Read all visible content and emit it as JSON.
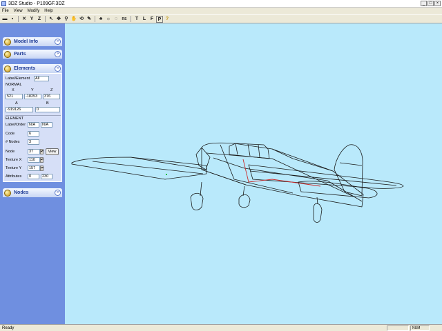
{
  "window": {
    "title": "3DZ Studio - P109GF.3DZ"
  },
  "menu": [
    "File",
    "View",
    "Modify",
    "Help"
  ],
  "toolbar": {
    "letter_buttons": {
      "t": "T",
      "l": "L",
      "f": "F",
      "p": "P"
    },
    "rs": "RS"
  },
  "panels": {
    "model_info": "Model Info",
    "parts": "Parts",
    "elements": "Elements",
    "nodes": "Nodes"
  },
  "elements_form": {
    "label_element_label": "Label/Element",
    "label_element_value": "All",
    "mode": "NORMAL",
    "x_label": "X",
    "y_label": "Y",
    "z_label": "Z",
    "x_value": "521",
    "y_value": "-18253",
    "z_value": "376",
    "a_label": "A",
    "b_label": "B",
    "a_value": "-919126",
    "b_value": "0",
    "element_header": "ELEMENT",
    "label_order_label": "Label/Order",
    "label_order_value1": "N/A",
    "label_order_value2": "N/A",
    "code_label": "Code",
    "code_value": "6",
    "nnodes_label": "# Nodes",
    "nnodes_value": "3",
    "node_label": "Node",
    "node_value": "37",
    "view_button": "View",
    "texture_x_label": "Texture X",
    "texture_x_value": "110",
    "texture_y_label": "Texture Y",
    "texture_y_value": "157",
    "attributes_label": "Attributes",
    "attributes_value1": "0",
    "attributes_value2": "230"
  },
  "status": {
    "left": "Ready",
    "right": "NUM"
  },
  "colors": {
    "viewport_bg": "#b9e9fb",
    "sidebar_bg": "#6f8fe0",
    "wireframe": "#1a1a1a",
    "highlight": "#cc2a2a",
    "node_marker": "#20c040"
  },
  "icons": {
    "toolbar": [
      "open-folder-icon",
      "save-icon",
      "axis-x-icon",
      "axis-y-icon",
      "axis-z-icon",
      "pointer-icon",
      "move-icon",
      "zoom-icon",
      "pan-hand-icon",
      "rotate-icon",
      "draw-icon",
      "paint-icon",
      "light-icon",
      "help-icon"
    ]
  }
}
